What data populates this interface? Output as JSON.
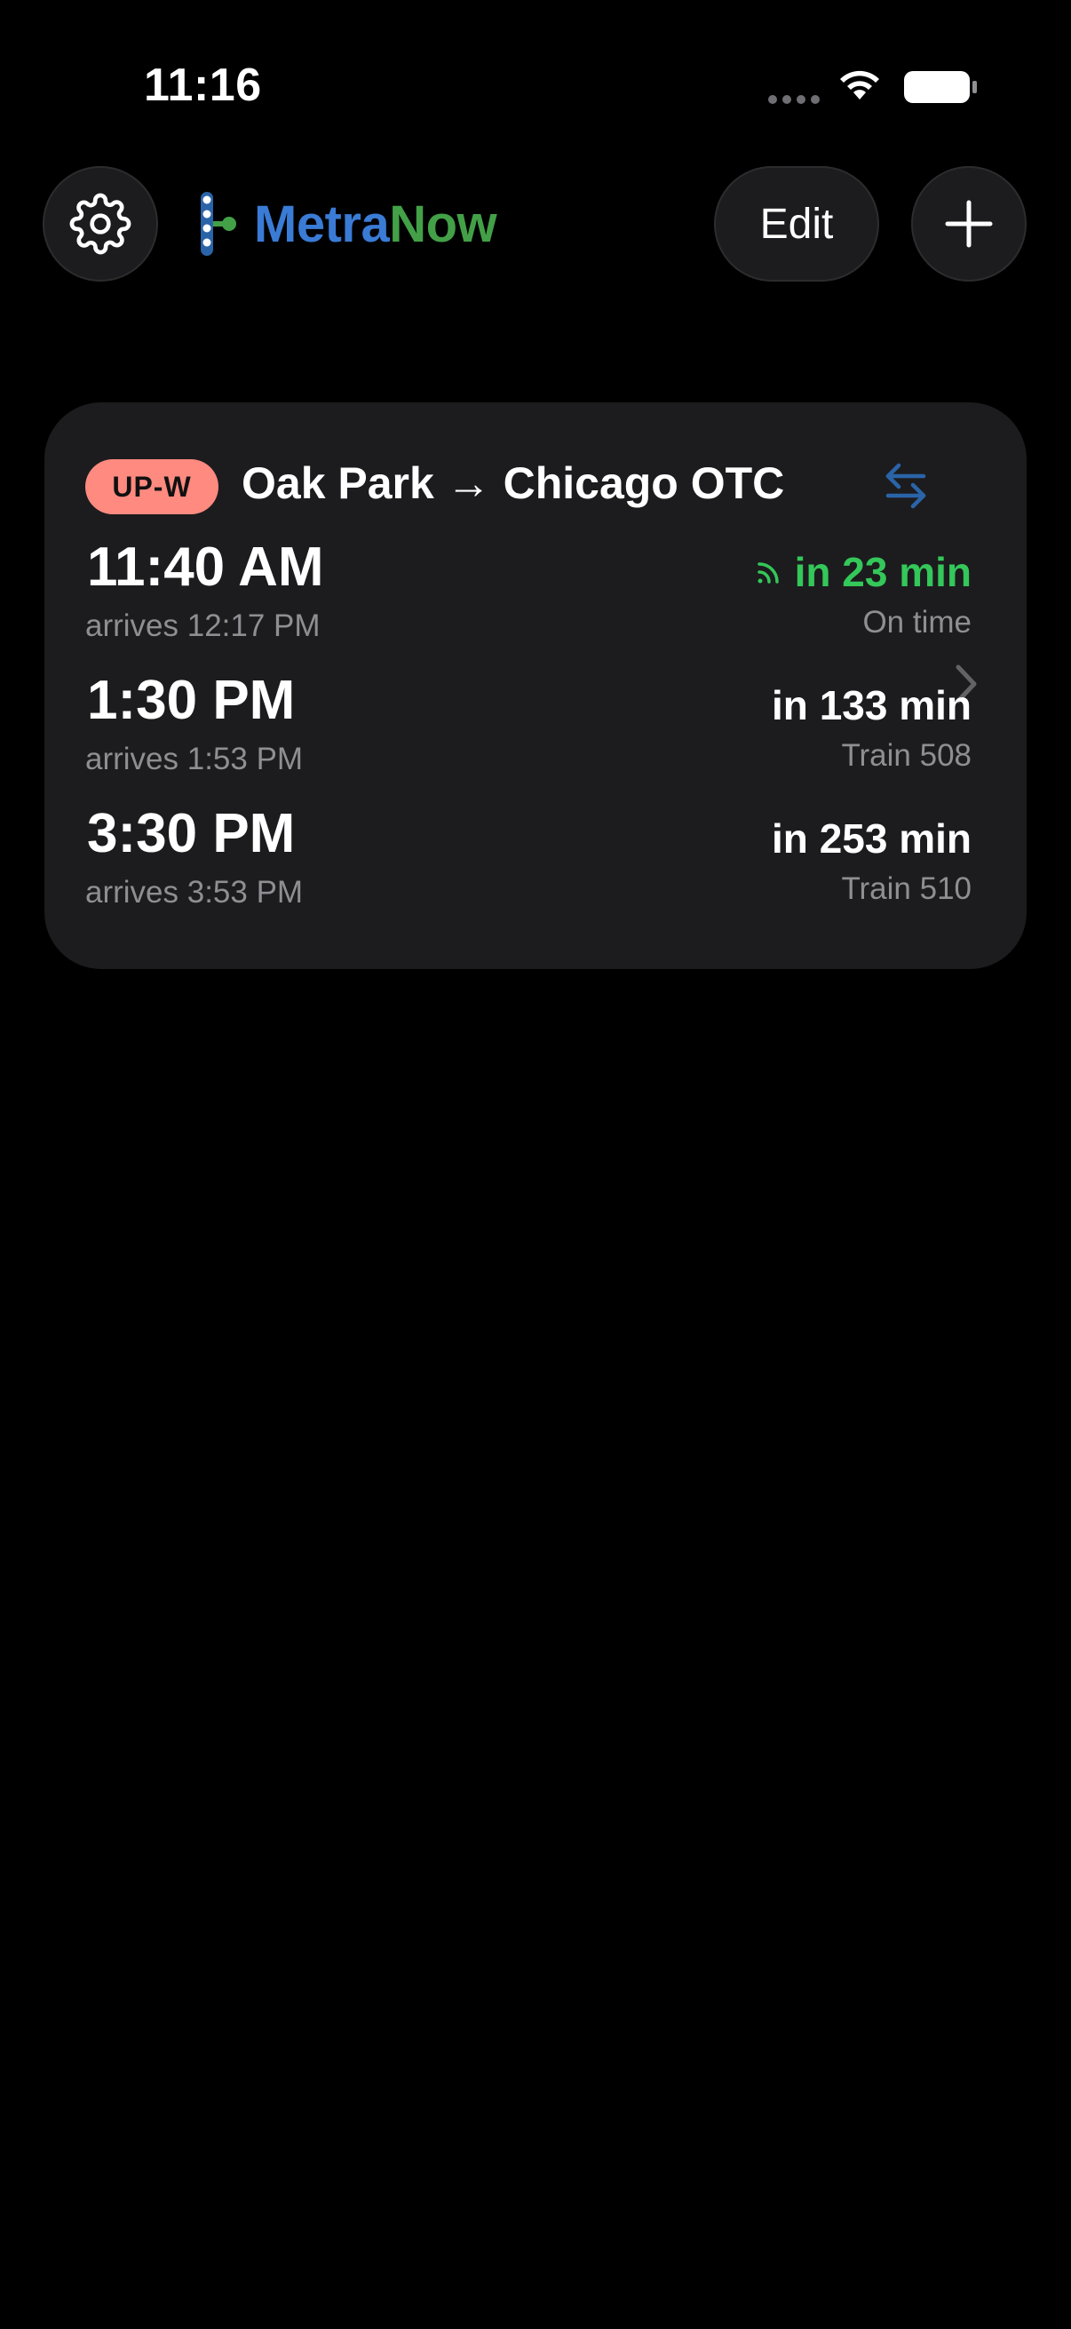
{
  "status_bar": {
    "time": "11:16",
    "icons": [
      "signal-dots-icon",
      "wifi-icon",
      "battery-icon"
    ]
  },
  "header": {
    "settings_icon": "gear-icon",
    "brand_part1": "Metra",
    "brand_part2": "Now",
    "edit_label": "Edit",
    "add_icon": "plus-icon"
  },
  "colors": {
    "background": "#000000",
    "card": "#1c1c1e",
    "brand_blue": "#3a7bd5",
    "brand_green": "#43a047",
    "route_badge": "#ff8a80",
    "live_green": "#34c759",
    "swap_blue": "#2a64a8",
    "secondary_text": "#8e8e93"
  },
  "route_card": {
    "line_badge": "UP-W",
    "title": "Oak Park → Chicago OTC",
    "swap_icon": "swap-arrows-icon",
    "chevron_icon": "chevron-right-icon",
    "trips": [
      {
        "depart": "11:40 AM",
        "arrive": "arrives 12:17 PM",
        "countdown": "in 23 min",
        "status": "On time",
        "live": true
      },
      {
        "depart": "1:30 PM",
        "arrive": "arrives 1:53 PM",
        "countdown": "in 133 min",
        "status": "Train 508",
        "live": false
      },
      {
        "depart": "3:30 PM",
        "arrive": "arrives 3:53 PM",
        "countdown": "in 253 min",
        "status": "Train 510",
        "live": false
      }
    ]
  }
}
